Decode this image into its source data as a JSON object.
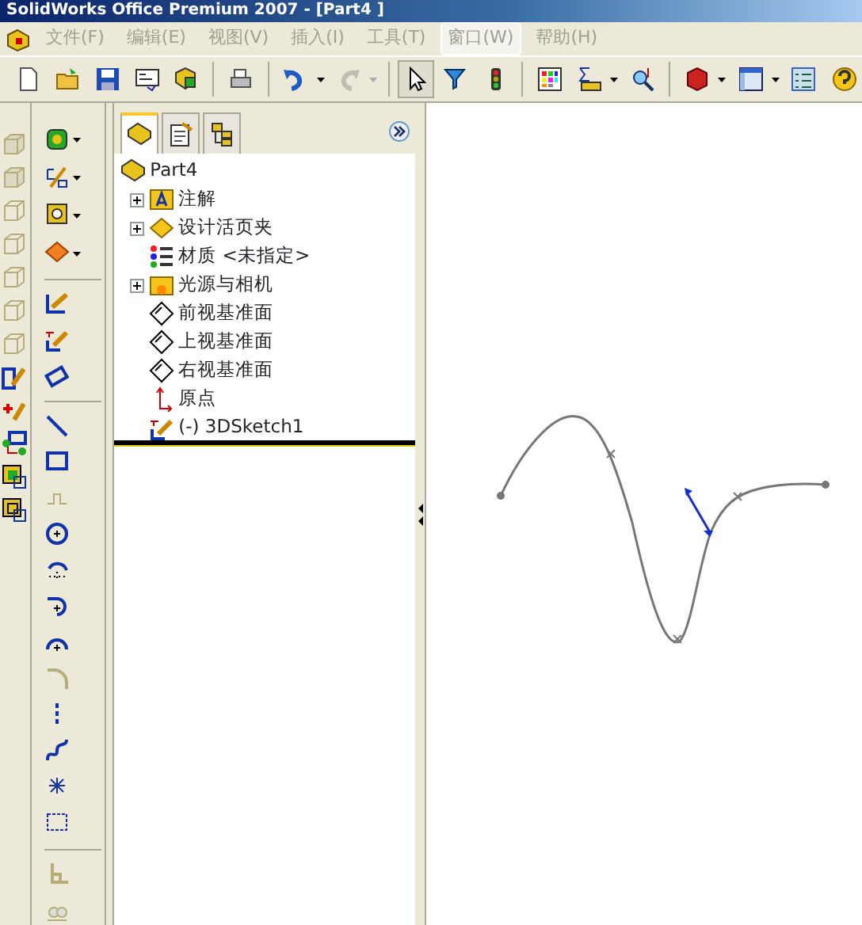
{
  "window": {
    "title": "SolidWorks Office Premium 2007 - [Part4  ]"
  },
  "menu": [
    {
      "label": "文件(F)",
      "highlighted": false
    },
    {
      "label": "编辑(E)",
      "highlighted": false
    },
    {
      "label": "视图(V)",
      "highlighted": false
    },
    {
      "label": "插入(I)",
      "highlighted": false
    },
    {
      "label": "工具(T)",
      "highlighted": false
    },
    {
      "label": "窗口(W)",
      "highlighted": true
    },
    {
      "label": "帮助(H)",
      "highlighted": false
    }
  ],
  "toolbar": [
    {
      "disabled": false,
      "pressed": false
    },
    {
      "disabled": false,
      "pressed": false
    },
    {
      "disabled": false,
      "pressed": false
    },
    {
      "disabled": false,
      "pressed": false
    },
    {
      "disabled": false,
      "pressed": false
    },
    {
      "disabled": false,
      "pressed": false
    },
    {
      "disabled": false,
      "pressed": false
    },
    {
      "disabled": true,
      "pressed": false
    },
    {
      "disabled": false,
      "pressed": true
    },
    {
      "disabled": false,
      "pressed": false
    },
    {
      "disabled": false,
      "pressed": false
    },
    {
      "disabled": false,
      "pressed": false
    },
    {
      "disabled": false,
      "pressed": false
    },
    {
      "disabled": false,
      "pressed": false
    },
    {
      "disabled": false,
      "pressed": false
    },
    {
      "disabled": false,
      "pressed": false
    },
    {
      "disabled": false,
      "pressed": false
    },
    {
      "disabled": false,
      "pressed": false
    }
  ],
  "panel_tabs": [
    {
      "selected": true
    },
    {
      "selected": false
    },
    {
      "selected": false
    }
  ],
  "tree": {
    "label": "Part4",
    "children": [
      {
        "label": "注解",
        "expandable": true
      },
      {
        "label": "设计活页夹",
        "expandable": true
      },
      {
        "label": "材质 <未指定>",
        "expandable": false
      },
      {
        "label": "光源与相机",
        "expandable": true
      },
      {
        "label": "前视基准面",
        "expandable": false
      },
      {
        "label": "上视基准面",
        "expandable": false
      },
      {
        "label": "右视基准面",
        "expandable": false
      },
      {
        "label": "原点",
        "expandable": false
      },
      {
        "label": "(-) 3DSketch1",
        "expandable": false
      }
    ]
  }
}
